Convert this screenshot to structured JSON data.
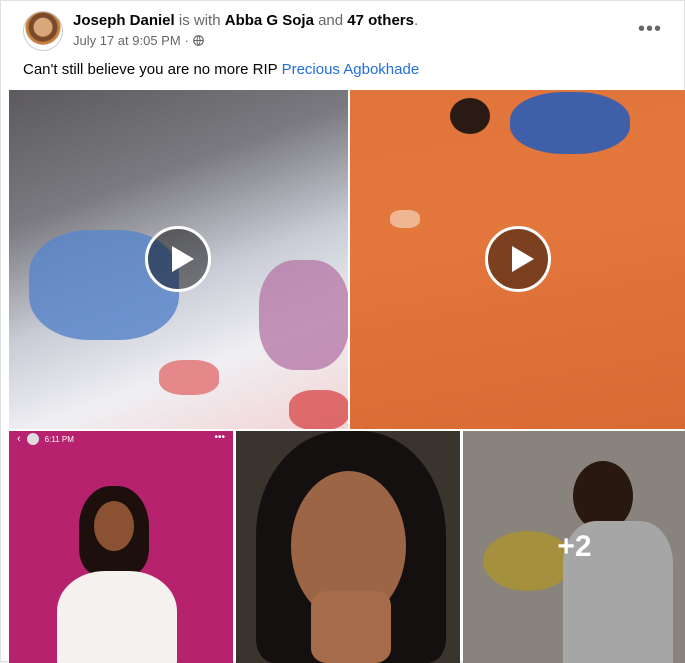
{
  "post": {
    "author": "Joseph Daniel",
    "with_word": "is with",
    "tagged_friend": "Abba G Soja",
    "and_word": "and",
    "others": "47 others",
    "period": ".",
    "date": "July 17 at 9:05 PM",
    "separator": "·",
    "privacy_icon": "globe-icon",
    "more_icon": "more-options-icon",
    "text_before_tag": "Can't still believe you are no more RIP",
    "tag_link": "Precious Agbokhade"
  },
  "media": {
    "videos": [
      {
        "icon": "play-icon"
      },
      {
        "icon": "play-icon"
      }
    ],
    "photos": [
      {
        "story_time": "6:11 PM"
      },
      {},
      {
        "more_count": "+2"
      }
    ]
  },
  "colors": {
    "link": "#216fdb",
    "name": "#050505",
    "muted": "#65676b"
  }
}
